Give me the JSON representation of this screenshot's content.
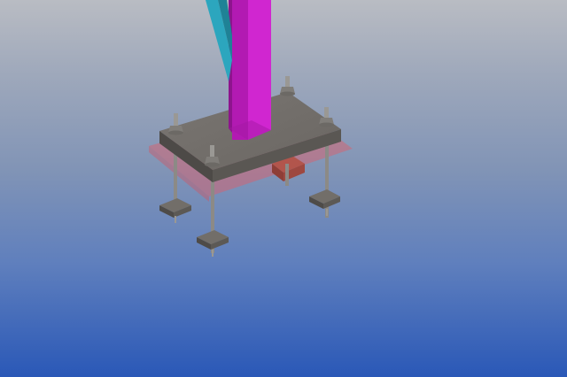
{
  "viewport": {
    "background_top": "#b9bcc3",
    "background_bottom": "#2a58b7"
  },
  "scene": {
    "objects": [
      {
        "name": "column",
        "color": "#c31bc3"
      },
      {
        "name": "brace",
        "color": "#2ba0b8"
      },
      {
        "name": "base-plate",
        "color": "#6e6a66"
      },
      {
        "name": "grout-zone",
        "color": "#e06a70"
      },
      {
        "name": "anchor-bolt",
        "count": 4,
        "color": "#8a8884"
      },
      {
        "name": "shear-lug",
        "color": "#a5473f"
      }
    ]
  }
}
